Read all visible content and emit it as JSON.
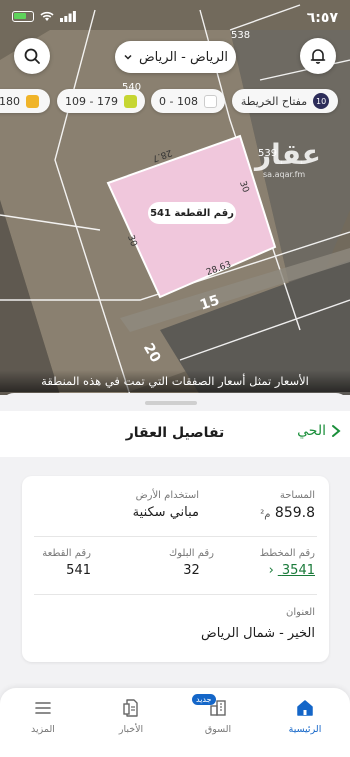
{
  "status_bar": {
    "time": "٦:٥٧"
  },
  "map": {
    "city_selector": "الرياض - الرياض",
    "legend": [
      {
        "label": "180",
        "color": "#f0b429"
      },
      {
        "label": "109 - 179",
        "color": "#c6d632"
      },
      {
        "label": "0 - 108",
        "color": "#ffffff"
      }
    ],
    "map_key_label": "مفتاح الخريطة",
    "map_key_count": "10",
    "plot_label": "رقم القطعة 541",
    "markers": [
      "538",
      "540",
      "539"
    ],
    "edge_labels": [
      "28.7",
      "30",
      "30",
      "28.63"
    ],
    "streets": [
      "15",
      "20"
    ],
    "watermark": "عقار",
    "watermark_sub": "sa.aqar.fm",
    "note": "الأسعار تمثل أسعار الصفقات التي تمت في هذه المنطقة"
  },
  "sheet": {
    "title": "تفاصيل العقار",
    "back_label": "الحي",
    "area_label": "المساحة",
    "area_value": "859.8",
    "area_unit": "م²",
    "land_use_label": "استخدام الأرض",
    "land_use_value": "مباني سكنية",
    "plan_label": "رقم المخطط",
    "plan_value": "3541",
    "block_label": "رقم البلوك",
    "block_value": "32",
    "plot_label": "رقم القطعة",
    "plot_value": "541",
    "address_label": "العنوان",
    "address_value": "الخير - شمال الرياض"
  },
  "nav": {
    "home": "الرئيسية",
    "market": "السوق",
    "news": "الأخبار",
    "more": "المزيد",
    "new_badge": "جديد"
  }
}
